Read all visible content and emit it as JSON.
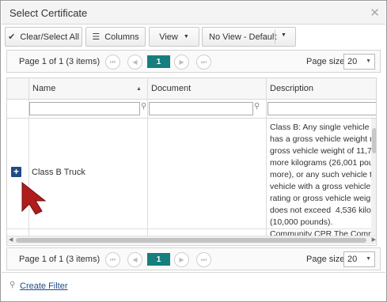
{
  "dialog": {
    "title": "Select Certificate"
  },
  "toolbar": {
    "clear_select_all": "Clear/Select All",
    "columns": "Columns",
    "view": "View",
    "view_select": "No View - Default"
  },
  "pager_top": {
    "info": "Page 1 of 1 (3 items)",
    "current_page": "1",
    "page_size_label": "Page size:",
    "page_size_value": "20"
  },
  "pager_bottom": {
    "info": "Page 1 of 1 (3 items)",
    "current_page": "1",
    "page_size_label": "Page size:",
    "page_size_value": "20"
  },
  "grid": {
    "columns": [
      "Name",
      "Document",
      "Description"
    ],
    "rows": [
      {
        "name": "Class B Truck",
        "document": "",
        "description": "Class B: Any single vehicle wh\nhas a gross vehicle weight rat\ngross vehicle weight of 11,79\nmore kilograms (26,001 poun\nmore), or any such vehicle to\nvehicle with a gross vehicle we\nrating or gross vehicle weight\ndoes not exceed  4,536 kilogr\n(10,000 pounds)."
      },
      {
        "name": "",
        "document": "",
        "description": "Community CPR The Commun"
      }
    ]
  },
  "footer": {
    "create_filter": "Create Filter"
  },
  "icons": {
    "close": "close-icon",
    "check": "check-icon",
    "list": "list-icon",
    "filter": "filter-icon",
    "expand": "plus-expand-icon",
    "cursor": "mouse-pointer-icon"
  },
  "colors": {
    "accent": "#167f7d",
    "link": "#1f4b87",
    "cursor": "#b01c1c"
  }
}
